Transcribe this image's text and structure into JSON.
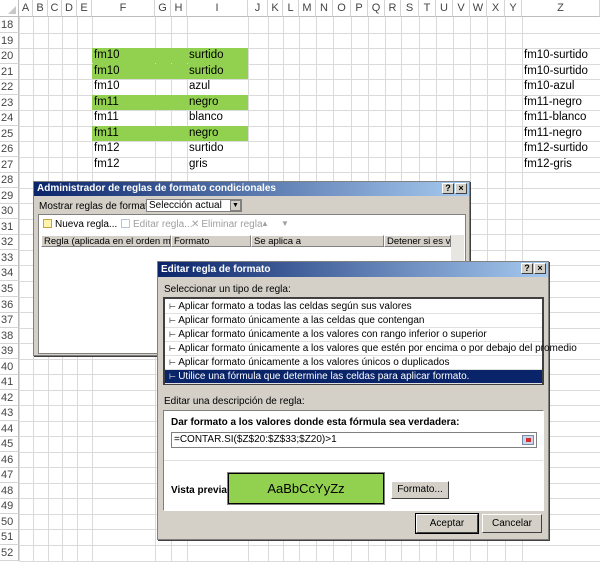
{
  "sheet": {
    "columns": [
      "A",
      "B",
      "C",
      "D",
      "E",
      "F",
      "G",
      "H",
      "I",
      "J",
      "K",
      "L",
      "M",
      "N",
      "O",
      "P",
      "Q",
      "R",
      "S",
      "T",
      "U",
      "V",
      "W",
      "X",
      "Y",
      "Z"
    ],
    "row_numbers": [
      18,
      19,
      20,
      21,
      22,
      23,
      24,
      25,
      26,
      27,
      28,
      29,
      30,
      31,
      32,
      33,
      34,
      35,
      36,
      37,
      38,
      39,
      40,
      41,
      42,
      43,
      44,
      45,
      46,
      47,
      48,
      49,
      50,
      51,
      52
    ],
    "highlight_color": "#92D050",
    "data_rows": [
      {
        "row": 20,
        "F": "fm10",
        "I": "surtido",
        "Z": "fm10-surtido",
        "highlight": true
      },
      {
        "row": 21,
        "F": "fm10",
        "I": "surtido",
        "Z": "fm10-surtido",
        "highlight": true
      },
      {
        "row": 22,
        "F": "fm10",
        "I": "azul",
        "Z": "fm10-azul",
        "highlight": false
      },
      {
        "row": 23,
        "F": "fm11",
        "I": "negro",
        "Z": "fm11-negro",
        "highlight": true
      },
      {
        "row": 24,
        "F": "fm11",
        "I": "blanco",
        "Z": "fm11-blanco",
        "highlight": false
      },
      {
        "row": 25,
        "F": "fm11",
        "I": "negro",
        "Z": "fm11-negro",
        "highlight": true
      },
      {
        "row": 26,
        "F": "fm12",
        "I": "surtido",
        "Z": "fm12-surtido",
        "highlight": false
      },
      {
        "row": 27,
        "F": "fm12",
        "I": "gris",
        "Z": "fm12-gris",
        "highlight": false
      }
    ]
  },
  "manager": {
    "title": "Administrador de reglas de formato condicionales",
    "help": "?",
    "close": "×",
    "show_label": "Mostrar reglas de formato para:",
    "show_value": "Selección actual",
    "new_rule": "Nueva regla...",
    "edit_rule": "Editar regla...",
    "delete_rule": "Eliminar regla",
    "up": "▲",
    "down": "▼",
    "headers": [
      "Regla (aplicada en el orden mostrado)",
      "Formato",
      "Se aplica a",
      "Detener si es verdad"
    ]
  },
  "editor": {
    "title": "Editar regla de formato",
    "help": "?",
    "close": "×",
    "select_label": "Seleccionar un tipo de regla:",
    "rule_types": [
      "Aplicar formato a todas las celdas según sus valores",
      "Aplicar formato únicamente a las celdas que contengan",
      "Aplicar formato únicamente a los valores con rango inferior o superior",
      "Aplicar formato únicamente a los valores que estén por encima o por debajo del promedio",
      "Aplicar formato únicamente a los valores únicos o duplicados",
      "Utilice una fórmula que determine las celdas para aplicar formato."
    ],
    "selected_index": 5,
    "desc_label": "Editar una descripción de regla:",
    "formula_label": "Dar formato a los valores donde esta fórmula sea verdadera:",
    "formula": "=CONTAR.SI($Z$20:$Z$33;$Z20)>1",
    "preview_label": "Vista previa:",
    "preview_text": "AaBbCcYyZz",
    "preview_color": "#92D050",
    "format_button": "Formato...",
    "ok": "Aceptar",
    "cancel": "Cancelar"
  }
}
